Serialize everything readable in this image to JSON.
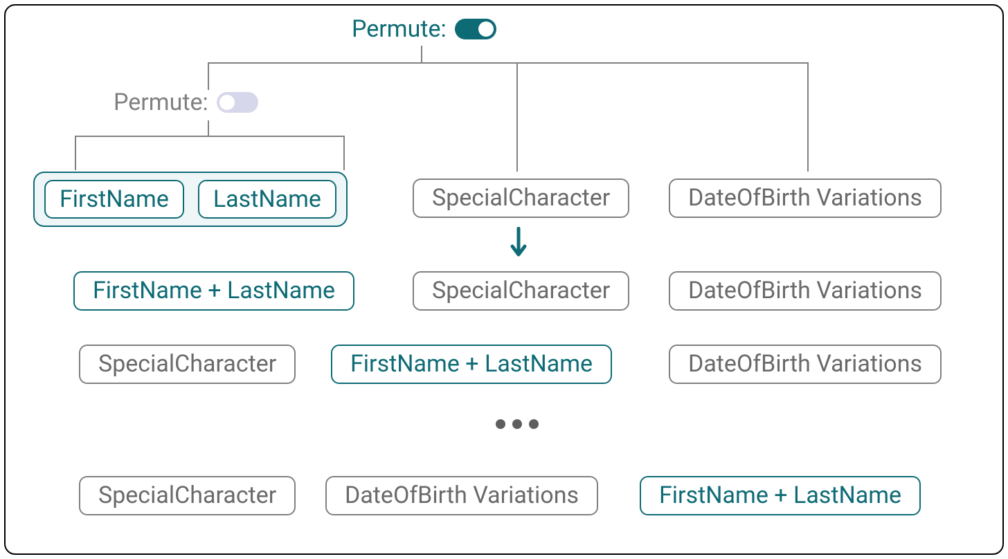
{
  "headers": {
    "top": "Permute:",
    "sub": "Permute:"
  },
  "toggles": {
    "top_on": true,
    "sub_on": false
  },
  "tokens": {
    "first_name": "FirstName",
    "last_name": "LastName",
    "special_char": "SpecialCharacter",
    "dob_variations": "DateOfBirth Variations",
    "first_plus_last": "FirstName + LastName"
  },
  "rows": {
    "row1": {
      "a": "FirstName + LastName",
      "b": "SpecialCharacter",
      "c": "DateOfBirth Variations"
    },
    "row2": {
      "a": "SpecialCharacter",
      "b": "FirstName + LastName",
      "c": "DateOfBirth Variations"
    },
    "row3": {
      "a": "SpecialCharacter",
      "b": "DateOfBirth Variations",
      "c": "FirstName + LastName"
    }
  }
}
